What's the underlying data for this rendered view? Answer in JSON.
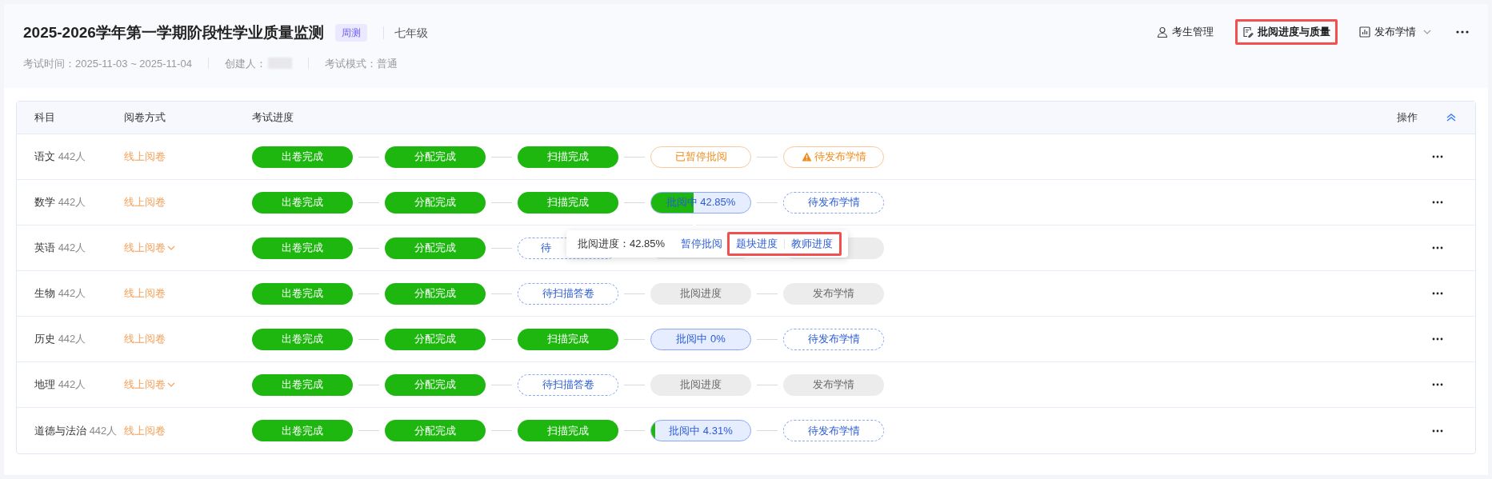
{
  "header": {
    "title": "2025-2026学年第一学期阶段性学业质量监测",
    "tag": "周测",
    "grade": "七年级",
    "meta": [
      {
        "kind": "text",
        "label": "考试时间：2025-11-03 ~ 2025-11-04"
      },
      {
        "kind": "redacted",
        "label": "创建人："
      },
      {
        "kind": "text",
        "label": "考试模式：普通"
      }
    ],
    "actions": [
      {
        "kind": "person",
        "label": "考生管理",
        "highlighted": false,
        "dropdown": false
      },
      {
        "kind": "edit",
        "label": "批阅进度与质量",
        "highlighted": true,
        "dropdown": false
      },
      {
        "kind": "chart",
        "label": "发布学情",
        "highlighted": false,
        "dropdown": true
      }
    ]
  },
  "table": {
    "columns": [
      "科目",
      "阅卷方式",
      "考试进度",
      "操作"
    ],
    "rows": [
      {
        "subject": "语文",
        "count": "442人",
        "method": "线上阅卷",
        "method_dropdown": false,
        "steps": [
          {
            "kind": "done",
            "label": "出卷完成"
          },
          {
            "kind": "done",
            "label": "分配完成"
          },
          {
            "kind": "done",
            "label": "扫描完成"
          },
          {
            "kind": "paused",
            "label": "已暂停批阅"
          },
          {
            "kind": "warning",
            "label": "待发布学情"
          }
        ]
      },
      {
        "subject": "数学",
        "count": "442人",
        "method": "线上阅卷",
        "method_dropdown": false,
        "steps": [
          {
            "kind": "done",
            "label": "出卷完成"
          },
          {
            "kind": "done",
            "label": "分配完成"
          },
          {
            "kind": "done",
            "label": "扫描完成"
          },
          {
            "kind": "progress",
            "label": "批阅中 42.85%",
            "level": 0.4285
          },
          {
            "kind": "pending",
            "label": "待发布学情"
          }
        ]
      },
      {
        "subject": "英语",
        "count": "442人",
        "method": "线上阅卷",
        "method_dropdown": true,
        "steps": [
          {
            "kind": "done",
            "label": "出卷完成"
          },
          {
            "kind": "done",
            "label": "分配完成"
          },
          {
            "kind": "pending",
            "label": "待",
            "covered": true
          },
          {
            "kind": "inactive",
            "covered": true
          },
          {
            "kind": "inactive",
            "covered": true
          }
        ]
      },
      {
        "subject": "生物",
        "count": "442人",
        "method": "线上阅卷",
        "method_dropdown": false,
        "steps": [
          {
            "kind": "done",
            "label": "出卷完成"
          },
          {
            "kind": "done",
            "label": "分配完成"
          },
          {
            "kind": "pending",
            "label": "待扫描答卷"
          },
          {
            "kind": "inactive",
            "label": "批阅进度"
          },
          {
            "kind": "inactive",
            "label": "发布学情"
          }
        ]
      },
      {
        "subject": "历史",
        "count": "442人",
        "method": "线上阅卷",
        "method_dropdown": false,
        "steps": [
          {
            "kind": "done",
            "label": "出卷完成"
          },
          {
            "kind": "done",
            "label": "分配完成"
          },
          {
            "kind": "done",
            "label": "扫描完成"
          },
          {
            "kind": "progress",
            "label": "批阅中 0%",
            "level": 0
          },
          {
            "kind": "pending",
            "label": "待发布学情"
          }
        ]
      },
      {
        "subject": "地理",
        "count": "442人",
        "method": "线上阅卷",
        "method_dropdown": true,
        "steps": [
          {
            "kind": "done",
            "label": "出卷完成"
          },
          {
            "kind": "done",
            "label": "分配完成"
          },
          {
            "kind": "pending",
            "label": "待扫描答卷"
          },
          {
            "kind": "inactive",
            "label": "批阅进度"
          },
          {
            "kind": "inactive",
            "label": "发布学情"
          }
        ]
      },
      {
        "subject": "道德与法治",
        "count": "442人",
        "method": "线上阅卷",
        "method_dropdown": false,
        "steps": [
          {
            "kind": "done",
            "label": "出卷完成"
          },
          {
            "kind": "done",
            "label": "分配完成"
          },
          {
            "kind": "done",
            "label": "扫描完成"
          },
          {
            "kind": "progress",
            "label": "批阅中 4.31%",
            "level": 0.0431
          },
          {
            "kind": "pending",
            "label": "待发布学情"
          }
        ]
      }
    ]
  },
  "popover": {
    "label": "批阅进度：42.85%",
    "pause_link": "暂停批阅",
    "highlighted_links": [
      "题块进度",
      "教师进度"
    ]
  }
}
